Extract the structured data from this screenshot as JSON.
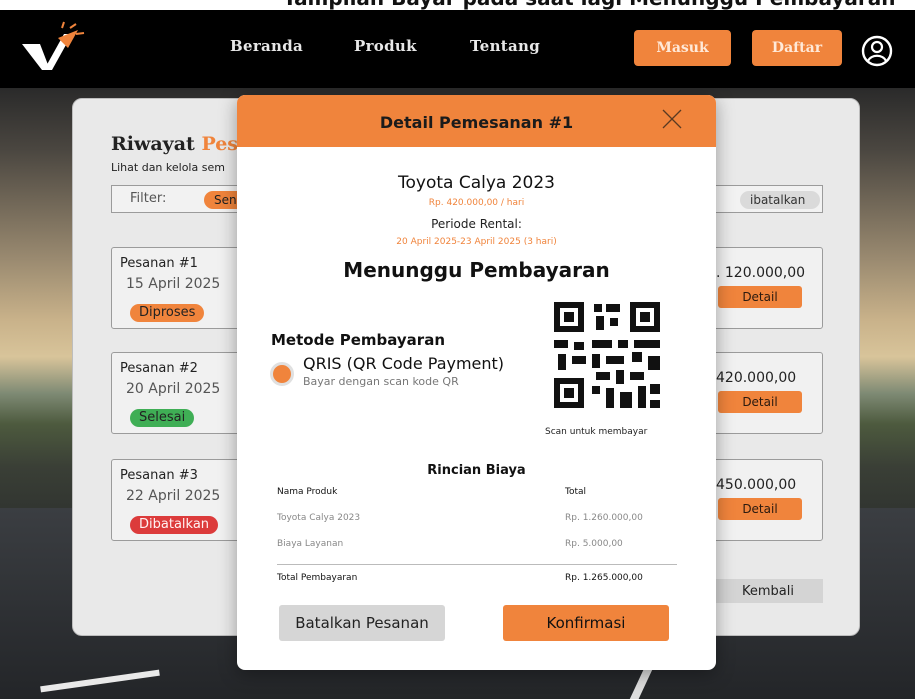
{
  "caption": "Tampilan Bayar pada saat lagi Menunggu Pembayaran",
  "navbar": {
    "links": [
      "Beranda",
      "Produk",
      "Tentang"
    ],
    "login_label": "Masuk",
    "register_label": "Daftar"
  },
  "history": {
    "title_part1": "Riwayat",
    "title_part2": "Pes",
    "subtitle": "Lihat dan kelola sem",
    "filter_label": "Filter:",
    "filter_all": "Sen",
    "filter_cancelled": "ibatalkan",
    "orders": [
      {
        "number": "Pesanan #1",
        "date": "15 April 2025",
        "status": "Diproses",
        "price": ". 120.000,00",
        "detail": "Detail"
      },
      {
        "number": "Pesanan #2",
        "date": "20 April 2025",
        "status": "Selesai",
        "price": "420.000,00",
        "detail": "Detail"
      },
      {
        "number": "Pesanan #3",
        "date": "22 April 2025",
        "status": "Dibatalkan",
        "price": "450.000,00",
        "detail": "Detail"
      }
    ],
    "back_label": "Kembali"
  },
  "modal": {
    "title": "Detail Pemesanan #1",
    "car_name": "Toyota Calya 2023",
    "car_price": "Rp. 420.000,00 / hari",
    "period_label": "Periode Rental:",
    "period_value": "20 April 2025-23 April 2025 (3 hari)",
    "status": "Menunggu Pembayaran",
    "payment": {
      "title": "Metode Pembayaran",
      "method": "QRIS (QR Code Payment)",
      "method_sub": "Bayar dengan scan kode QR",
      "qr_caption": "Scan untuk membayar"
    },
    "costs": {
      "title": "Rincian Biaya",
      "header_label": "Nama Produk",
      "header_value": "Total",
      "rows": [
        {
          "label": "Toyota Calya 2023",
          "value": "Rp. 1.260.000,00"
        },
        {
          "label": "Biaya Layanan",
          "value": "Rp. 5.000,00"
        }
      ],
      "total_label": "Total Pembayaran",
      "total_value": "Rp. 1.265.000,00"
    },
    "cancel_label": "Batalkan Pesanan",
    "confirm_label": "Konfirmasi"
  },
  "colors": {
    "accent": "#f0843c",
    "success": "#3fae55",
    "danger": "#dc3b3b"
  }
}
